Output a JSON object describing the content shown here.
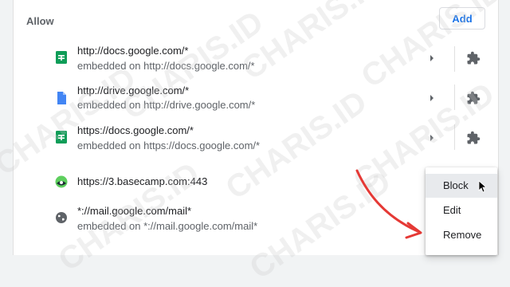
{
  "section": {
    "title": "Allow",
    "add_label": "Add"
  },
  "sites": [
    {
      "url": "http://docs.google.com/*",
      "embedded": "embedded on http://docs.google.com/*",
      "icon": "google-sheets-icon",
      "color": "#0f9d58"
    },
    {
      "url": "http://drive.google.com/*",
      "embedded": "embedded on http://drive.google.com/*",
      "icon": "google-docs-icon",
      "color": "#4285f4"
    },
    {
      "url": "https://docs.google.com/*",
      "embedded": "embedded on https://docs.google.com/*",
      "icon": "google-sheets-icon",
      "color": "#0f9d58"
    },
    {
      "url": "https://3.basecamp.com:443",
      "embedded": "",
      "icon": "basecamp-icon",
      "color": "#5ecf5e"
    },
    {
      "url": "*://mail.google.com/mail*",
      "embedded": "embedded on *://mail.google.com/mail*",
      "icon": "globe-icon",
      "color": "#5f6368"
    }
  ],
  "context_menu": {
    "items": [
      "Block",
      "Edit",
      "Remove"
    ],
    "highlighted": "Block"
  },
  "watermark": "CHARIS.ID",
  "colors": {
    "accent": "#1a73e8",
    "arrow": "#e53935"
  }
}
